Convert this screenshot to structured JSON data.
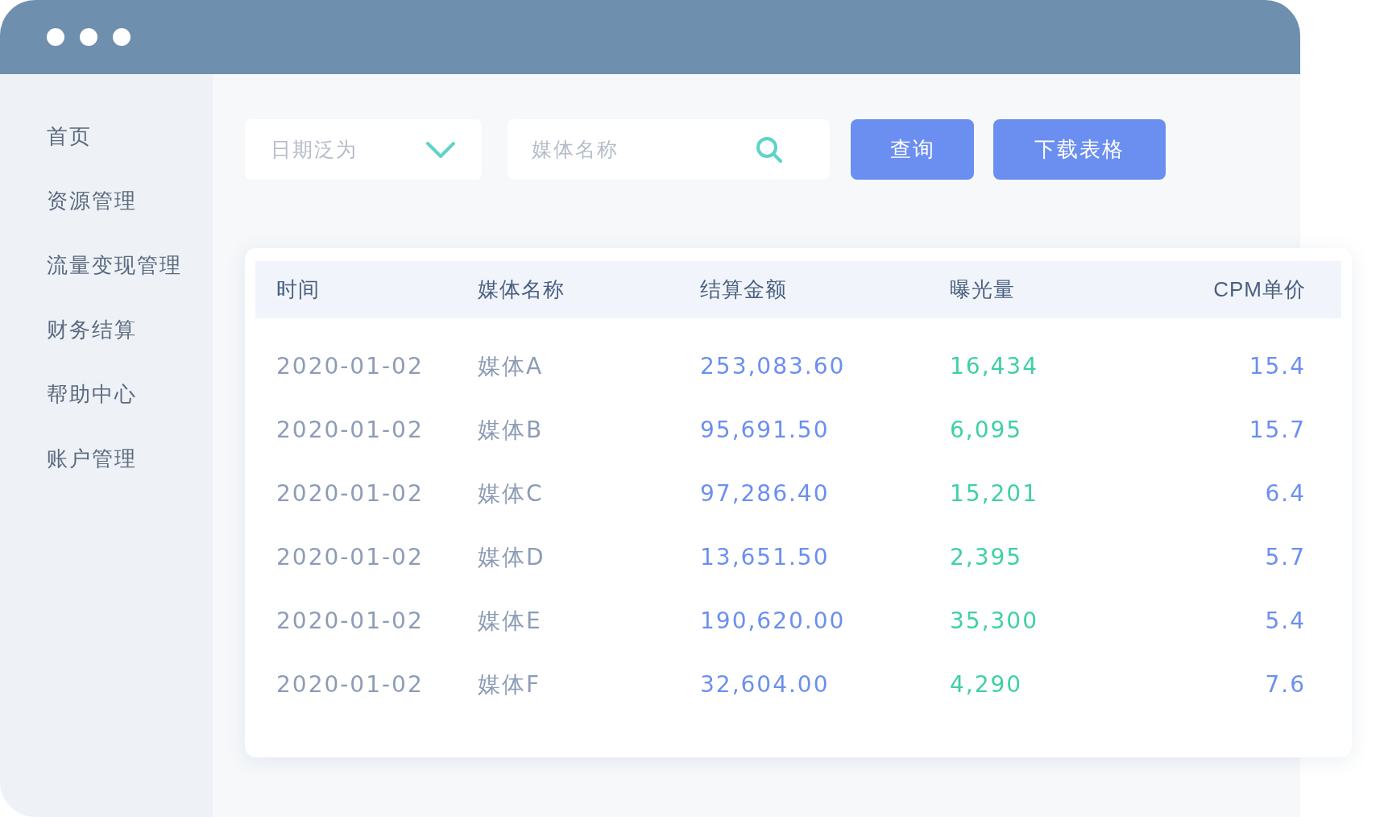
{
  "sidebar": {
    "items": [
      {
        "label": "首页"
      },
      {
        "label": "资源管理"
      },
      {
        "label": "流量变现管理"
      },
      {
        "label": "财务结算"
      },
      {
        "label": "帮助中心"
      },
      {
        "label": "账户管理"
      }
    ]
  },
  "toolbar": {
    "date_select": {
      "placeholder": "日期泛为"
    },
    "search": {
      "placeholder": "媒体名称"
    },
    "buttons": [
      "查询",
      "下载表格"
    ]
  },
  "table": {
    "columns": [
      "时间",
      "媒体名称",
      "结算金额",
      "曝光量",
      "CPM单价"
    ],
    "rows": [
      [
        "2020-01-02",
        "媒体A",
        "253,083.60",
        "16,434",
        "15.4"
      ],
      [
        "2020-01-02",
        "媒体B",
        "95,691.50",
        "6,095",
        "15.7"
      ],
      [
        "2020-01-02",
        "媒体C",
        "97,286.40",
        "15,201",
        "6.4"
      ],
      [
        "2020-01-02",
        "媒体D",
        "13,651.50",
        "2,395",
        "5.7"
      ],
      [
        "2020-01-02",
        "媒体E",
        "190,620.00",
        "35,300",
        "5.4"
      ],
      [
        "2020-01-02",
        "媒体F",
        "32,604.00",
        "4,290",
        "7.6"
      ]
    ]
  }
}
